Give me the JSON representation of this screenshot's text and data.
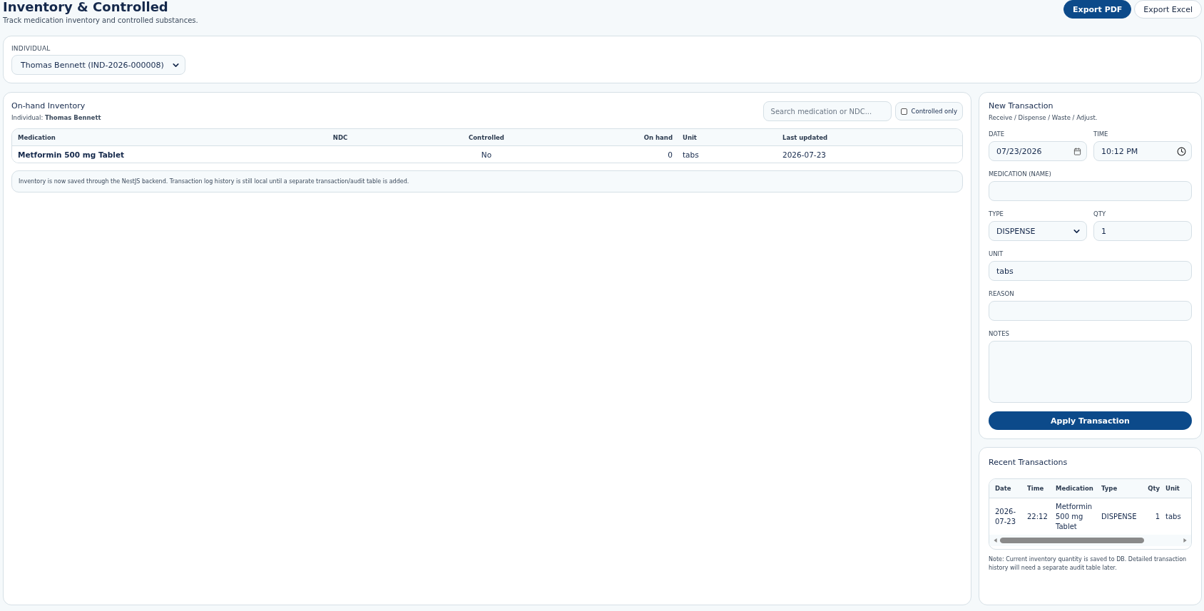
{
  "header": {
    "title": "Inventory & Controlled",
    "subtitle": "Track medication inventory and controlled substances.",
    "buttons": [
      {
        "label": "Export PDF",
        "kind": "primary"
      },
      {
        "label": "Export Excel",
        "kind": "secondary"
      }
    ]
  },
  "individual": {
    "label": "INDIVIDUAL",
    "value": "Thomas Bennett (IND-2026-000008)"
  },
  "inventory": {
    "title": "On-hand Inventory",
    "individual_label": "Individual:",
    "individual_name": "Thomas Bennett",
    "search": {
      "placeholder": "Search medication or NDC..."
    },
    "filter": {
      "label": "Controlled only",
      "checked": false
    },
    "columns": [
      "Medication",
      "NDC",
      "Controlled",
      "On hand",
      "Unit",
      "Last updated"
    ],
    "rows": [
      [
        "Metformin 500 mg Tablet",
        "",
        "No",
        "0",
        "tabs",
        "2026-07-23"
      ]
    ],
    "note": "Inventory is now saved through the NestJS backend. Transaction log history is still local until a separate transaction/audit table is added."
  },
  "transaction": {
    "title": "New Transaction",
    "subtitle": "Receive / Dispense / Waste / Adjust.",
    "field_rows": [
      [
        {
          "label": "DATE",
          "kind": "date",
          "value": "07/23/2026"
        },
        {
          "label": "TIME",
          "kind": "time",
          "value": "10:12 PM"
        }
      ],
      [
        {
          "label": "MEDICATION (NAME)",
          "kind": "text"
        }
      ],
      [
        {
          "label": "TYPE",
          "kind": "select",
          "value": "DISPENSE"
        },
        {
          "label": "QTY",
          "kind": "text",
          "value": "1"
        }
      ],
      [
        {
          "label": "UNIT",
          "kind": "text",
          "value": "tabs"
        }
      ],
      [
        {
          "label": "REASON",
          "kind": "text"
        }
      ],
      [
        {
          "label": "NOTES",
          "kind": "textarea"
        }
      ]
    ],
    "button": "Apply Transaction"
  },
  "recent": {
    "title": "Recent Transactions",
    "columns": [
      "Date",
      "Time",
      "Medication",
      "Type",
      "Qty",
      "Unit"
    ],
    "rows": [
      [
        "2026-07-23",
        "22:12",
        "Metformin 500 mg Tablet",
        "DISPENSE",
        "1",
        "tabs"
      ]
    ],
    "note": "Note: Current inventory quantity is saved to DB. Detailed transaction history will need a separate audit table later."
  }
}
